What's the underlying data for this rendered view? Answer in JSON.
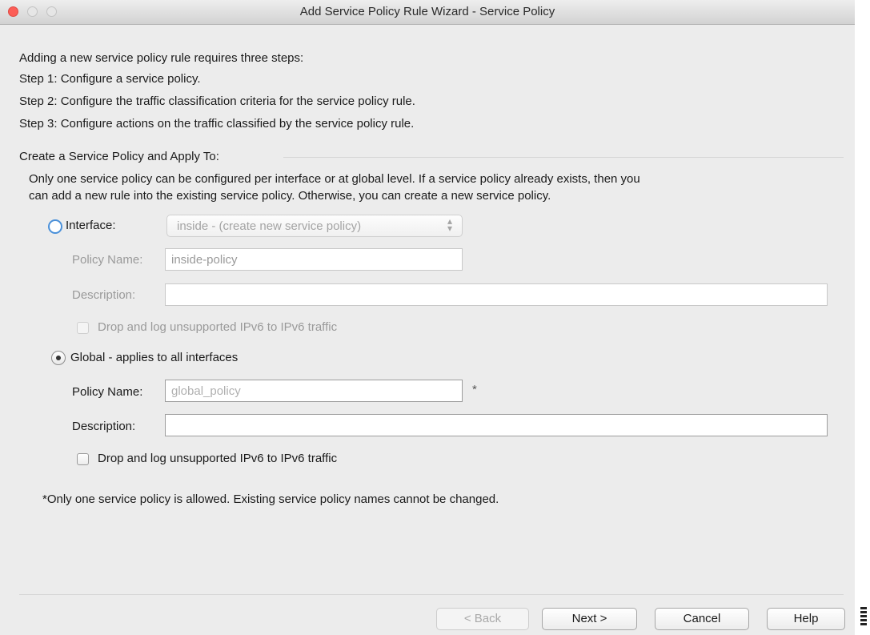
{
  "window": {
    "title": "Add Service Policy Rule Wizard - Service Policy"
  },
  "intro": {
    "line1": "Adding a new service policy rule requires three steps:",
    "step1": "Step 1:  Configure a service policy.",
    "step2": "Step 2:  Configure the traffic classification criteria for the service policy rule.",
    "step3": "Step 3:  Configure actions on the traffic classified by the service policy rule."
  },
  "section": {
    "title": "Create a Service Policy and Apply To:",
    "note_line1": "Only one service policy can be configured per interface or at global level. If a service policy already exists, then you",
    "note_line2": "can add a new rule into the existing service policy. Otherwise, you can create a new service policy."
  },
  "interface_option": {
    "label": "Interface:",
    "selected": false,
    "select_value": "inside - (create new service policy)",
    "policy_name_label": "Policy Name:",
    "policy_name_value": "inside-policy",
    "description_label": "Description:",
    "description_value": "",
    "checkbox_label": "Drop and log unsupported IPv6 to IPv6 traffic",
    "checkbox_checked": false
  },
  "global_option": {
    "label": "Global - applies to all interfaces",
    "selected": true,
    "policy_name_label": "Policy Name:",
    "policy_name_value": "global_policy",
    "required_mark": "*",
    "description_label": "Description:",
    "description_value": "",
    "checkbox_label": "Drop and log unsupported IPv6 to IPv6 traffic",
    "checkbox_checked": false
  },
  "footnote": "*Only one service policy is allowed. Existing service policy names cannot be changed.",
  "buttons": {
    "back": "< Back",
    "next": "Next >",
    "cancel": "Cancel",
    "help": "Help"
  },
  "colors": {
    "radio_accent": "#4a90d9",
    "close_button": "#fc5d56"
  }
}
